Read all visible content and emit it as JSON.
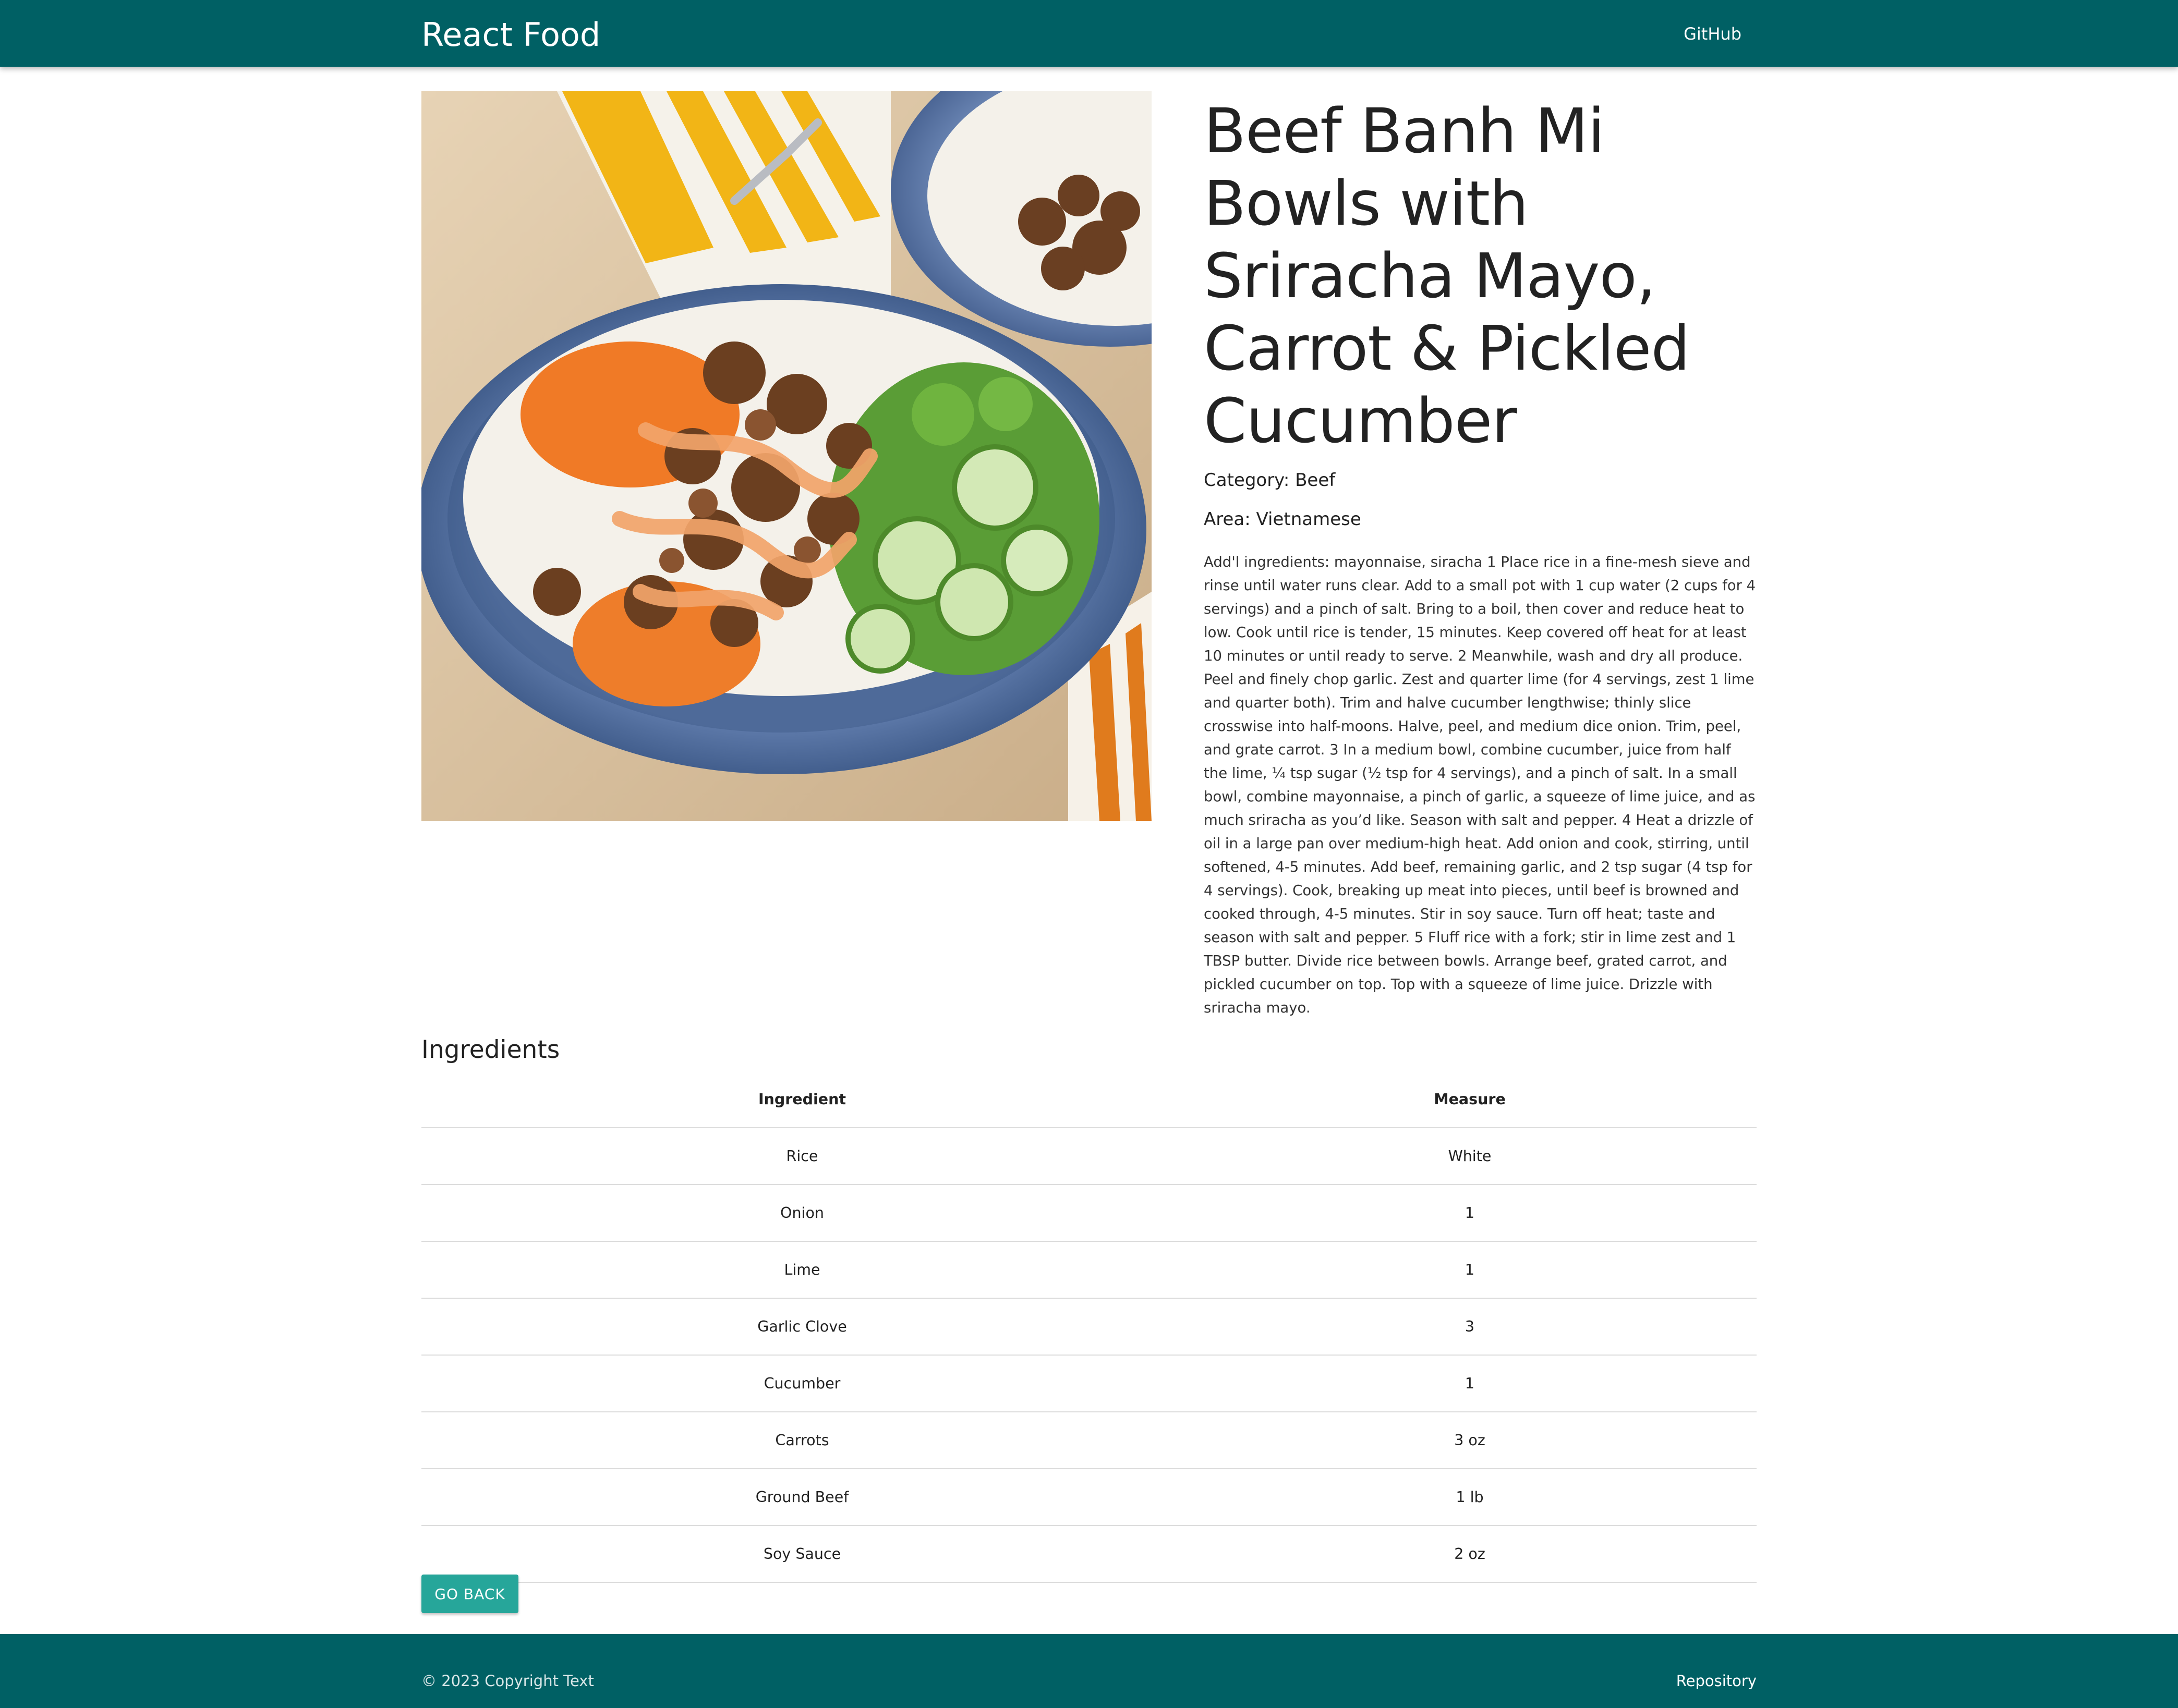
{
  "navbar": {
    "brand": "React Food",
    "github_link": "GitHub"
  },
  "recipe": {
    "image_alt": "Beef Banh Mi Bowls with Sriracha Mayo, Carrot & Pickled Cucumber",
    "title": "Beef Banh Mi Bowls with Sriracha Mayo, Carrot & Pickled Cucumber",
    "category": "Category: Beef",
    "area": "Area: Vietnamese",
    "instructions": "Add'l ingredients: mayonnaise, siracha 1 Place rice in a fine-mesh sieve and rinse until water runs clear. Add to a small pot with 1 cup water (2 cups for 4 servings) and a pinch of salt. Bring to a boil, then cover and reduce heat to low. Cook until rice is tender, 15 minutes. Keep covered off heat for at least 10 minutes or until ready to serve. 2 Meanwhile, wash and dry all produce. Peel and finely chop garlic. Zest and quarter lime (for 4 servings, zest 1 lime and quarter both). Trim and halve cucumber lengthwise; thinly slice crosswise into half-moons. Halve, peel, and medium dice onion. Trim, peel, and grate carrot. 3 In a medium bowl, combine cucumber, juice from half the lime, ¼ tsp sugar (½ tsp for 4 servings), and a pinch of salt. In a small bowl, combine mayonnaise, a pinch of garlic, a squeeze of lime juice, and as much sriracha as you’d like. Season with salt and pepper. 4 Heat a drizzle of oil in a large pan over medium-high heat. Add onion and cook, stirring, until softened, 4-5 minutes. Add beef, remaining garlic, and 2 tsp sugar (4 tsp for 4 servings). Cook, breaking up meat into pieces, until beef is browned and cooked through, 4-5 minutes. Stir in soy sauce. Turn off heat; taste and season with salt and pepper. 5 Fluff rice with a fork; stir in lime zest and 1 TBSP butter. Divide rice between bowls. Arrange beef, grated carrot, and pickled cucumber on top. Top with a squeeze of lime juice. Drizzle with sriracha mayo."
  },
  "ingredients": {
    "heading": "Ingredients",
    "columns": [
      "Ingredient",
      "Measure"
    ],
    "rows": [
      {
        "ingredient": "Rice",
        "measure": "White"
      },
      {
        "ingredient": "Onion",
        "measure": "1"
      },
      {
        "ingredient": "Lime",
        "measure": "1"
      },
      {
        "ingredient": "Garlic Clove",
        "measure": "3"
      },
      {
        "ingredient": "Cucumber",
        "measure": "1"
      },
      {
        "ingredient": "Carrots",
        "measure": "3 oz"
      },
      {
        "ingredient": "Ground Beef",
        "measure": "1 lb"
      },
      {
        "ingredient": "Soy Sauce",
        "measure": "2 oz"
      }
    ]
  },
  "actions": {
    "go_back": "GO BACK"
  },
  "footer": {
    "copyright": "© 2023 Copyright Text",
    "repository_link": "Repository"
  },
  "colors": {
    "primary_teal": "#006064",
    "button_teal": "#26a69a",
    "divider": "#dcdcdc"
  }
}
